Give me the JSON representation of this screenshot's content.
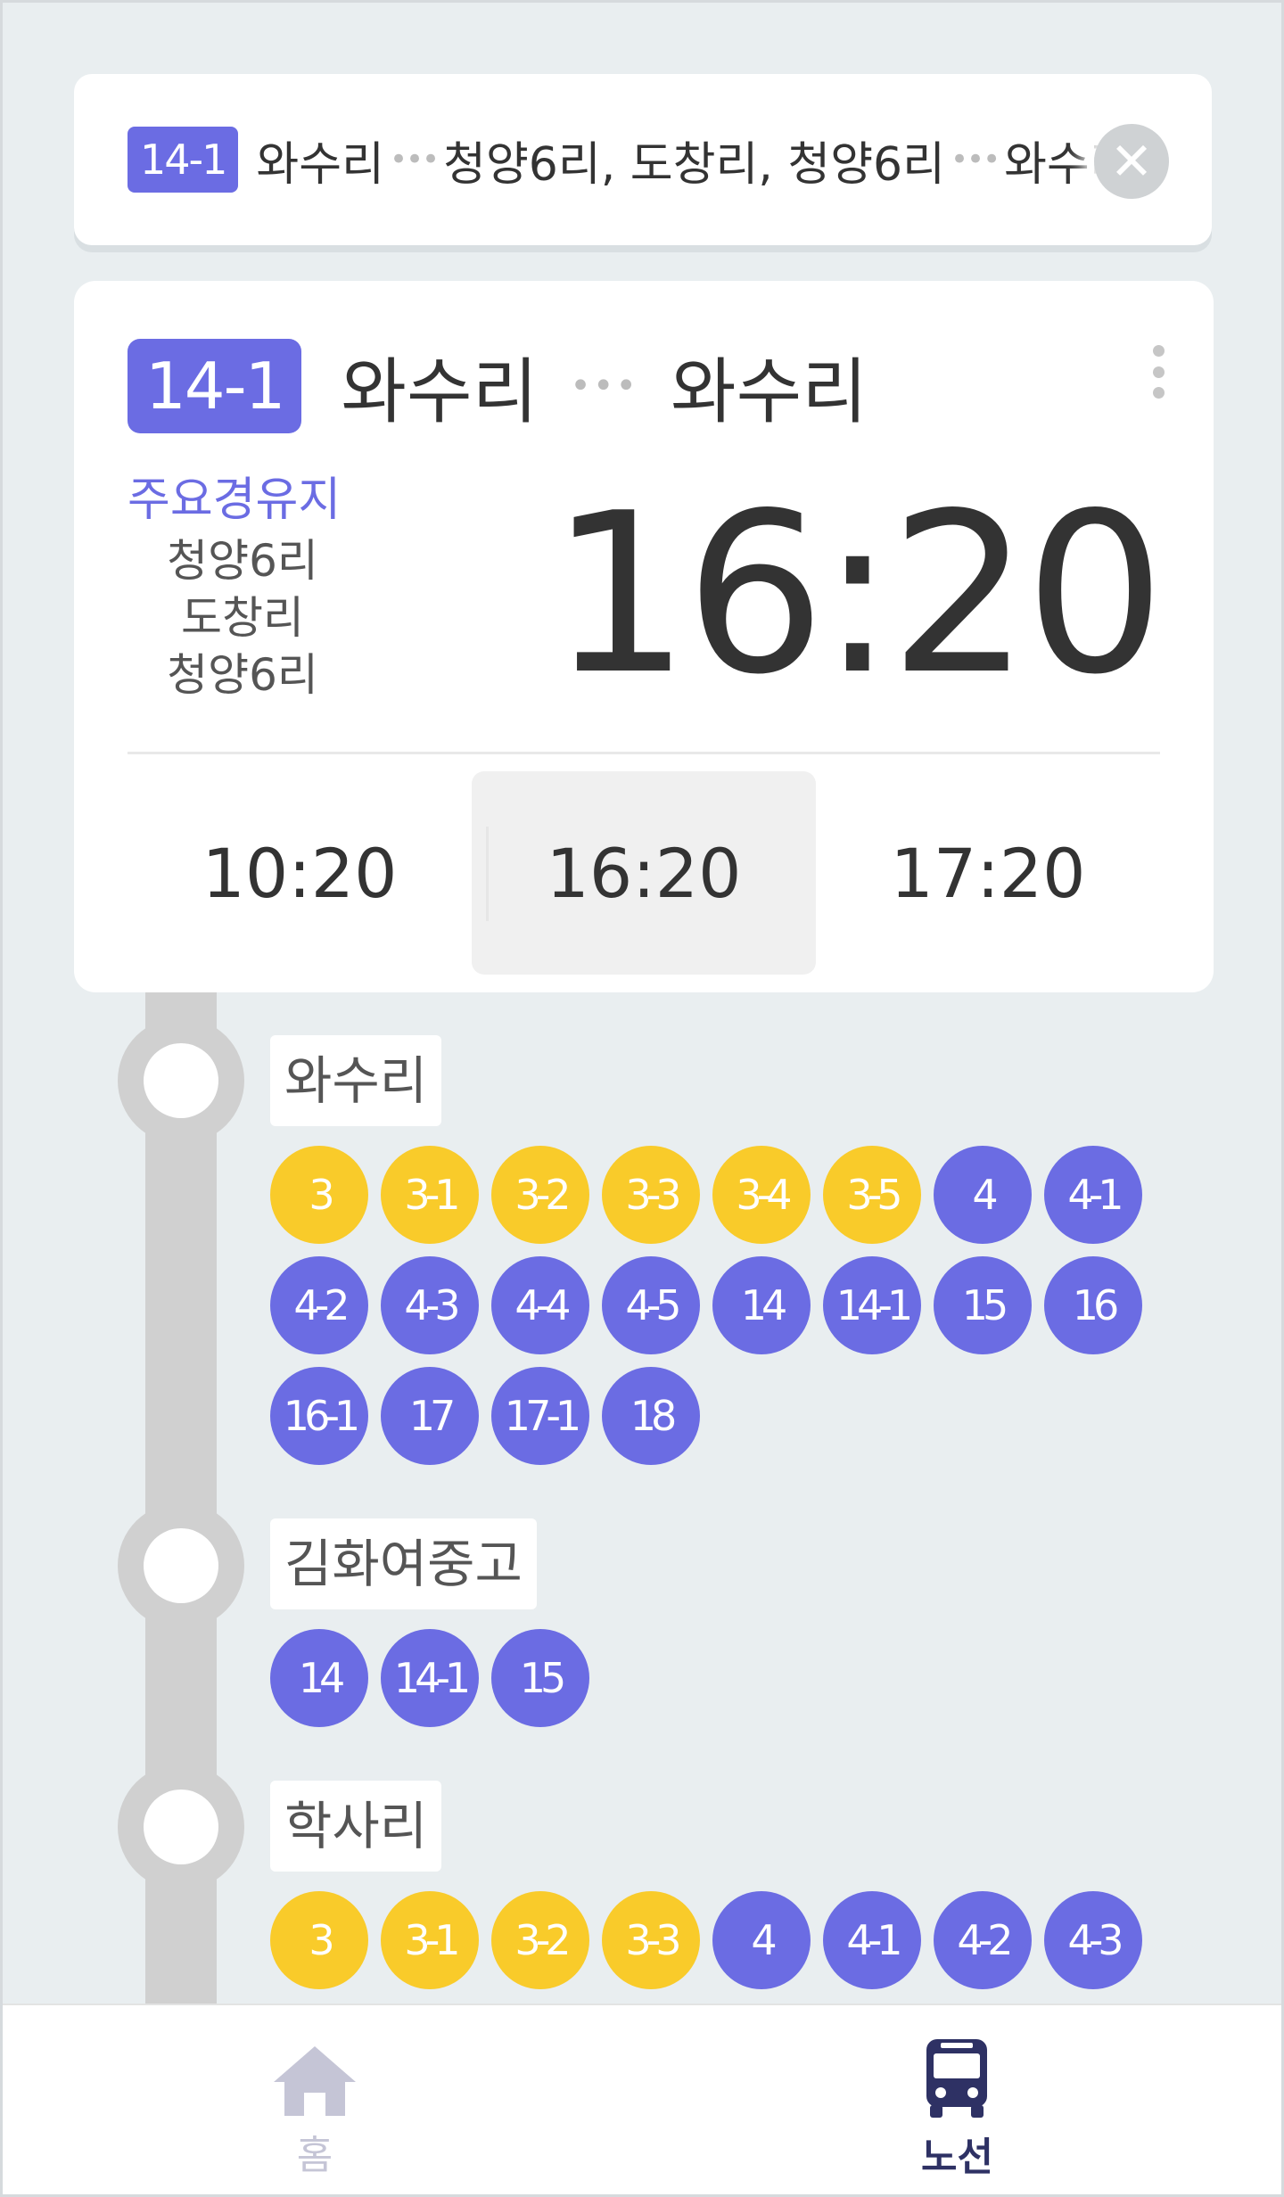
{
  "route_bar": {
    "badge": "14-1",
    "origin": "와수리",
    "dots": "•••",
    "via": "청양6리, 도창리, 청양6리",
    "destination": "와수리",
    "close_icon": "close-icon"
  },
  "card": {
    "badge": "14-1",
    "origin": "와수리",
    "dots": "•••",
    "destination": "와수리",
    "more_icon": "more-vertical-icon",
    "via_title": "주요경유지",
    "via_stops": [
      "청양6리",
      "도창리",
      "청양6리"
    ],
    "selected_time": "16:20",
    "times": [
      "10:20",
      "16:20",
      "17:20"
    ]
  },
  "stops": [
    {
      "name": "와수리",
      "routes": [
        {
          "label": "3",
          "color": "yellow"
        },
        {
          "label": "3-1",
          "color": "yellow"
        },
        {
          "label": "3-2",
          "color": "yellow"
        },
        {
          "label": "3-3",
          "color": "yellow"
        },
        {
          "label": "3-4",
          "color": "yellow"
        },
        {
          "label": "3-5",
          "color": "yellow"
        },
        {
          "label": "4",
          "color": "purple"
        },
        {
          "label": "4-1",
          "color": "purple"
        },
        {
          "label": "4-2",
          "color": "purple"
        },
        {
          "label": "4-3",
          "color": "purple"
        },
        {
          "label": "4-4",
          "color": "purple"
        },
        {
          "label": "4-5",
          "color": "purple"
        },
        {
          "label": "14",
          "color": "purple"
        },
        {
          "label": "14-1",
          "color": "purple"
        },
        {
          "label": "15",
          "color": "purple"
        },
        {
          "label": "16",
          "color": "purple"
        },
        {
          "label": "16-1",
          "color": "purple"
        },
        {
          "label": "17",
          "color": "purple"
        },
        {
          "label": "17-1",
          "color": "purple"
        },
        {
          "label": "18",
          "color": "purple"
        }
      ]
    },
    {
      "name": "김화여중고",
      "routes": [
        {
          "label": "14",
          "color": "purple"
        },
        {
          "label": "14-1",
          "color": "purple"
        },
        {
          "label": "15",
          "color": "purple"
        }
      ]
    },
    {
      "name": "학사리",
      "routes": [
        {
          "label": "3",
          "color": "yellow"
        },
        {
          "label": "3-1",
          "color": "yellow"
        },
        {
          "label": "3-2",
          "color": "yellow"
        },
        {
          "label": "3-3",
          "color": "yellow"
        },
        {
          "label": "4",
          "color": "purple"
        },
        {
          "label": "4-1",
          "color": "purple"
        },
        {
          "label": "4-2",
          "color": "purple"
        },
        {
          "label": "4-3",
          "color": "purple"
        }
      ]
    }
  ],
  "colors": {
    "accent": "#6b6ce3",
    "yellow": "#f9cb2a",
    "nav_active": "#2e3164",
    "nav_inactive": "#c5c5d6"
  },
  "bottom_nav": {
    "home_label": "홈",
    "home_icon": "home-icon",
    "route_label": "노선",
    "route_icon": "bus-icon"
  }
}
